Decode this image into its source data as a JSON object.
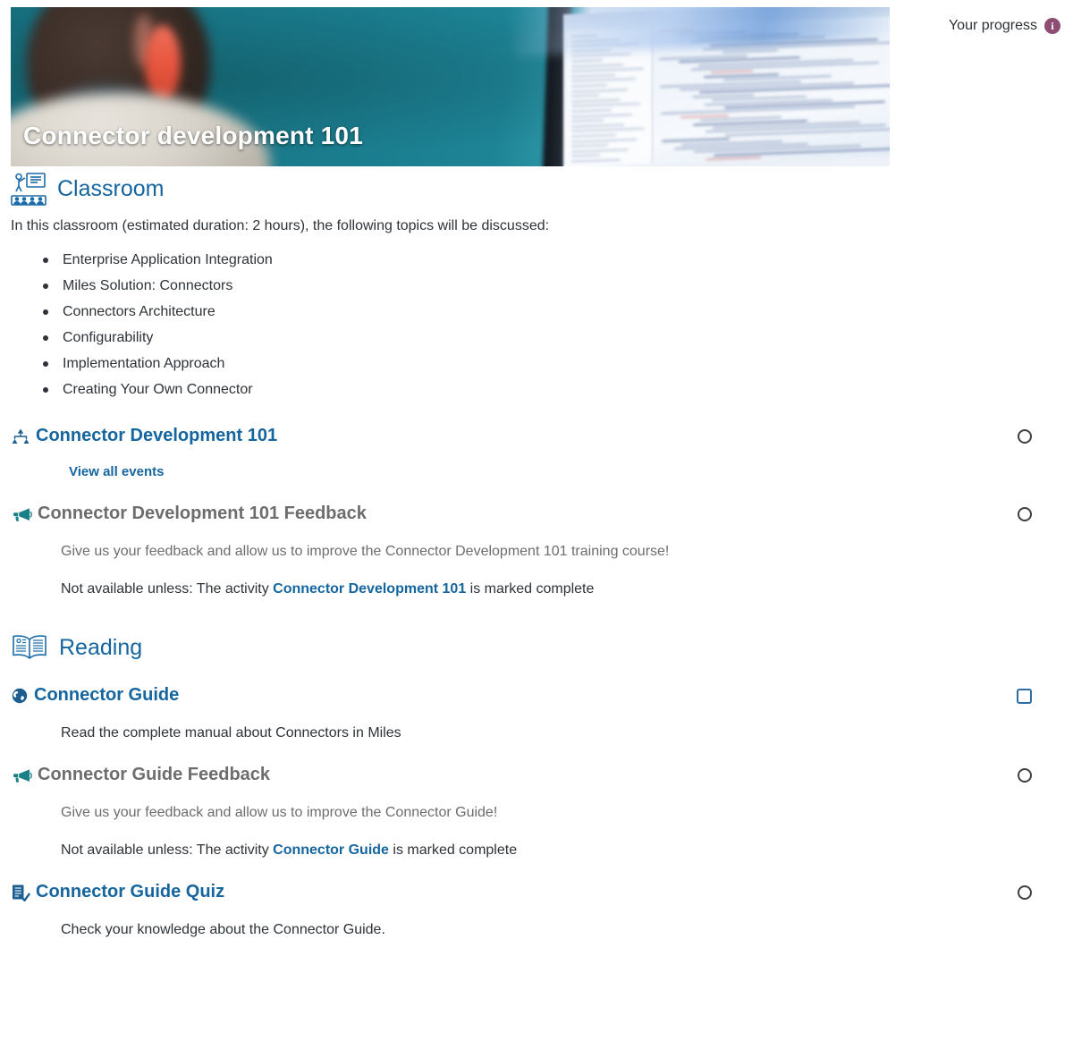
{
  "header": {
    "course_title": "Connector development 101",
    "progress_label": "Your progress",
    "info_icon": "info-icon"
  },
  "sections": [
    {
      "id": "classroom",
      "icon": "classroom-icon",
      "title": "Classroom",
      "intro": "In this classroom (estimated duration: 2 hours), the following topics will be discussed:",
      "topics": [
        "Enterprise Application Integration",
        "Miles Solution: Connectors",
        "Connectors Architecture",
        "Configurability",
        "Implementation Approach",
        "Creating Your Own Connector"
      ],
      "activities": [
        {
          "id": "connector-development-101",
          "icon": "hierarchy-icon",
          "title": "Connector Development 101",
          "title_color": "#15659f",
          "sub_link": "View all events",
          "completion": "circle"
        },
        {
          "id": "connector-development-101-feedback",
          "icon": "megaphone-icon",
          "title": "Connector Development 101 Feedback",
          "title_color": "#6d6d6d",
          "description": "Give us your feedback and allow us to improve the Connector Development 101 training course!",
          "restriction_prefix": "Not available unless: The activity ",
          "restriction_link": "Connector Development 101",
          "restriction_suffix": " is marked complete",
          "completion": "circle"
        }
      ]
    },
    {
      "id": "reading",
      "icon": "open-book-icon",
      "title": "Reading",
      "activities": [
        {
          "id": "connector-guide",
          "icon": "globe-icon",
          "title": "Connector Guide",
          "title_color": "#15659f",
          "description": "Read the complete manual about Connectors in Miles",
          "completion": "square"
        },
        {
          "id": "connector-guide-feedback",
          "icon": "megaphone-icon",
          "title": "Connector Guide Feedback",
          "title_color": "#6d6d6d",
          "description": "Give us your feedback and allow us to improve the Connector Guide!",
          "restriction_prefix": "Not available unless: The activity ",
          "restriction_link": "Connector Guide",
          "restriction_suffix": " is marked complete",
          "completion": "circle"
        },
        {
          "id": "connector-guide-quiz",
          "icon": "quiz-icon",
          "title": "Connector Guide Quiz",
          "title_color": "#15659f",
          "description": "Check your knowledge about the Connector Guide.",
          "completion": "circle"
        }
      ]
    }
  ],
  "colors": {
    "link_blue": "#15659f",
    "muted_gray": "#6d6d6d",
    "body_text": "#2d3338",
    "teal_icon": "#1a7f86",
    "info_purple": "#8e4e73",
    "banner_teal": "#1b7b8c"
  }
}
